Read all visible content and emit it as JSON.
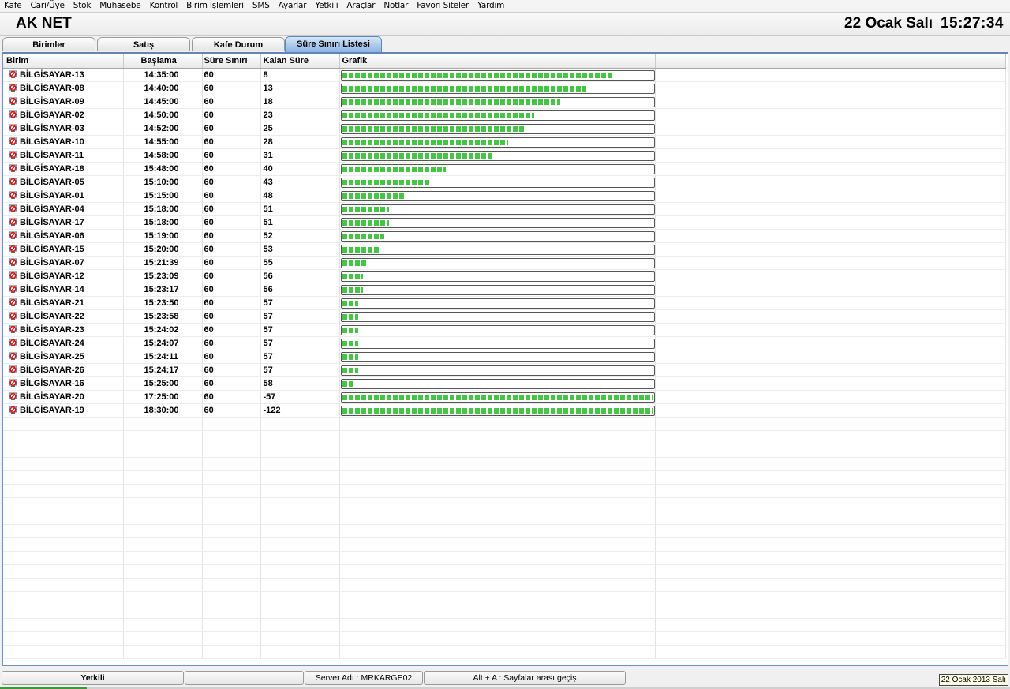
{
  "menu": [
    "Kafe",
    "Cari/Üye",
    "Stok",
    "Muhasebe",
    "Kontrol",
    "Birim İşlemleri",
    "SMS",
    "Ayarlar",
    "Yetkili",
    "Araçlar",
    "Notlar",
    "Favori Siteler",
    "Yardım"
  ],
  "header": {
    "title": "AK NET",
    "date": "22 Ocak Salı",
    "time": "15:27:34"
  },
  "tabs": [
    {
      "label": "Birimler",
      "active": false
    },
    {
      "label": "Satış",
      "active": false
    },
    {
      "label": "Kafe Durum",
      "active": false
    },
    {
      "label": "Süre Sınırı Listesi",
      "active": true
    }
  ],
  "table": {
    "columns": [
      "Birim",
      "Başlama",
      "Süre Sınırı",
      "Kalan Süre",
      "Grafik"
    ],
    "rows": [
      {
        "name": "BİLGİSAYAR-13",
        "start": "14:35:00",
        "limit": "60",
        "left": "8",
        "elapsed_fraction": 0.8667
      },
      {
        "name": "BİLGİSAYAR-08",
        "start": "14:40:00",
        "limit": "60",
        "left": "13",
        "elapsed_fraction": 0.7833
      },
      {
        "name": "BİLGİSAYAR-09",
        "start": "14:45:00",
        "limit": "60",
        "left": "18",
        "elapsed_fraction": 0.7
      },
      {
        "name": "BİLGİSAYAR-02",
        "start": "14:50:00",
        "limit": "60",
        "left": "23",
        "elapsed_fraction": 0.6167
      },
      {
        "name": "BİLGİSAYAR-03",
        "start": "14:52:00",
        "limit": "60",
        "left": "25",
        "elapsed_fraction": 0.5833
      },
      {
        "name": "BİLGİSAYAR-10",
        "start": "14:55:00",
        "limit": "60",
        "left": "28",
        "elapsed_fraction": 0.5333
      },
      {
        "name": "BİLGİSAYAR-11",
        "start": "14:58:00",
        "limit": "60",
        "left": "31",
        "elapsed_fraction": 0.4833
      },
      {
        "name": "BİLGİSAYAR-18",
        "start": "15:48:00",
        "limit": "60",
        "left": "40",
        "elapsed_fraction": 0.3333
      },
      {
        "name": "BİLGİSAYAR-05",
        "start": "15:10:00",
        "limit": "60",
        "left": "43",
        "elapsed_fraction": 0.2833
      },
      {
        "name": "BİLGİSAYAR-01",
        "start": "15:15:00",
        "limit": "60",
        "left": "48",
        "elapsed_fraction": 0.2
      },
      {
        "name": "BİLGİSAYAR-04",
        "start": "15:18:00",
        "limit": "60",
        "left": "51",
        "elapsed_fraction": 0.15
      },
      {
        "name": "BİLGİSAYAR-17",
        "start": "15:18:00",
        "limit": "60",
        "left": "51",
        "elapsed_fraction": 0.15
      },
      {
        "name": "BİLGİSAYAR-06",
        "start": "15:19:00",
        "limit": "60",
        "left": "52",
        "elapsed_fraction": 0.1333
      },
      {
        "name": "BİLGİSAYAR-15",
        "start": "15:20:00",
        "limit": "60",
        "left": "53",
        "elapsed_fraction": 0.1167
      },
      {
        "name": "BİLGİSAYAR-07",
        "start": "15:21:39",
        "limit": "60",
        "left": "55",
        "elapsed_fraction": 0.0833
      },
      {
        "name": "BİLGİSAYAR-12",
        "start": "15:23:09",
        "limit": "60",
        "left": "56",
        "elapsed_fraction": 0.0667
      },
      {
        "name": "BİLGİSAYAR-14",
        "start": "15:23:17",
        "limit": "60",
        "left": "56",
        "elapsed_fraction": 0.0667
      },
      {
        "name": "BİLGİSAYAR-21",
        "start": "15:23:50",
        "limit": "60",
        "left": "57",
        "elapsed_fraction": 0.05
      },
      {
        "name": "BİLGİSAYAR-22",
        "start": "15:23:58",
        "limit": "60",
        "left": "57",
        "elapsed_fraction": 0.05
      },
      {
        "name": "BİLGİSAYAR-23",
        "start": "15:24:02",
        "limit": "60",
        "left": "57",
        "elapsed_fraction": 0.05
      },
      {
        "name": "BİLGİSAYAR-24",
        "start": "15:24:07",
        "limit": "60",
        "left": "57",
        "elapsed_fraction": 0.05
      },
      {
        "name": "BİLGİSAYAR-25",
        "start": "15:24:11",
        "limit": "60",
        "left": "57",
        "elapsed_fraction": 0.05
      },
      {
        "name": "BİLGİSAYAR-26",
        "start": "15:24:17",
        "limit": "60",
        "left": "57",
        "elapsed_fraction": 0.05
      },
      {
        "name": "BİLGİSAYAR-16",
        "start": "15:25:00",
        "limit": "60",
        "left": "58",
        "elapsed_fraction": 0.0333
      },
      {
        "name": "BİLGİSAYAR-20",
        "start": "17:25:00",
        "limit": "60",
        "left": "-57",
        "elapsed_fraction": 1.0
      },
      {
        "name": "BİLGİSAYAR-19",
        "start": "18:30:00",
        "limit": "60",
        "left": "-122",
        "elapsed_fraction": 1.0
      }
    ]
  },
  "status": {
    "role": "Yetkili",
    "empty": "",
    "server": "Server Adı : MRKARGE02",
    "hint": "Alt + A : Sayfalar arası geçiş",
    "date": "22 Ocak 2013 Salı"
  },
  "colors": {
    "bar_fill": "#45c445",
    "active_tab": "#8bb3e3",
    "panel_border": "#6b93c6"
  },
  "icons": {
    "unit": "no-entry-monitor-icon"
  }
}
